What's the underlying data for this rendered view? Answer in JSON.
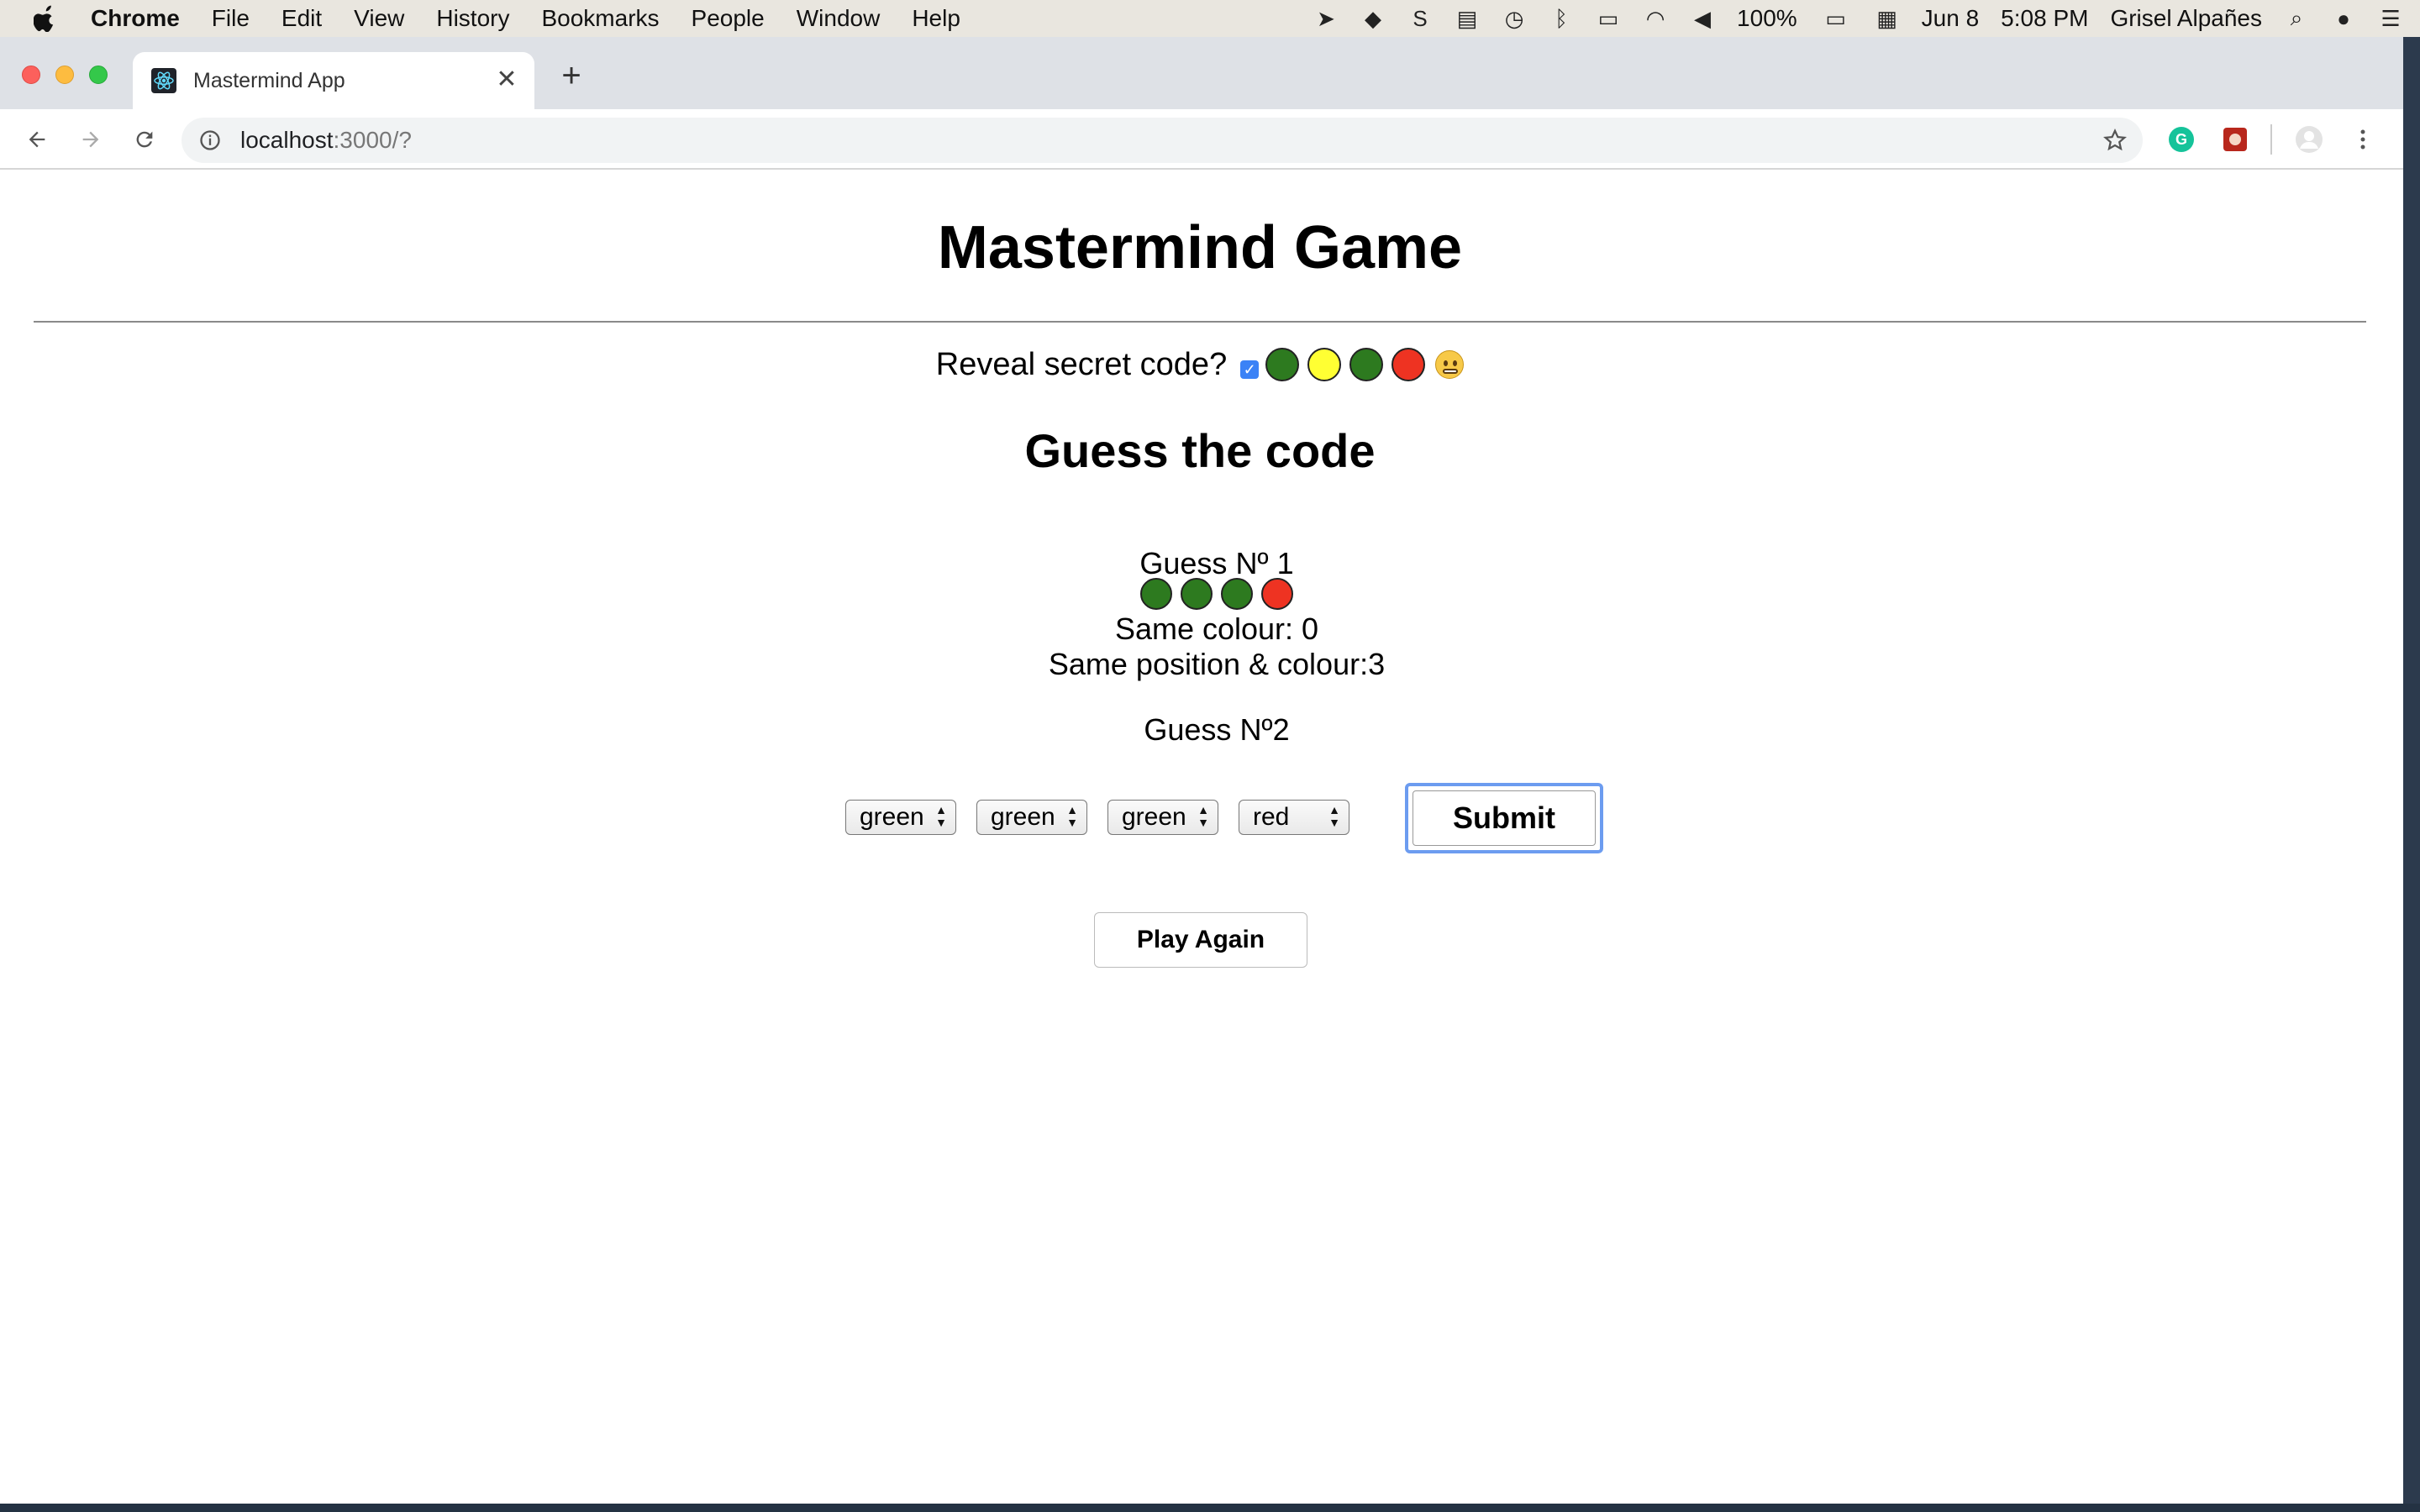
{
  "menubar": {
    "app": "Chrome",
    "items": [
      "File",
      "Edit",
      "View",
      "History",
      "Bookmarks",
      "People",
      "Window",
      "Help"
    ],
    "battery": "100%",
    "date": "Jun 8",
    "time": "5:08 PM",
    "user": "Grisel Alpañes",
    "status_icons": [
      "location-icon",
      "dropbox-icon",
      "skype-icon",
      "sync-icon",
      "time-machine-icon",
      "bluetooth-icon",
      "airplay-icon",
      "wifi-icon",
      "volume-icon",
      "battery-icon",
      "calendar-icon",
      "spotlight-icon",
      "siri-icon",
      "notification-center-icon"
    ]
  },
  "browser": {
    "tab_title": "Mastermind App",
    "url_host": "localhost",
    "url_rest": ":3000/?"
  },
  "colors": {
    "green": "#2d7a1f",
    "yellow": "#ffff33",
    "red": "#ee3322",
    "focus": "#6c9cf0"
  },
  "game": {
    "title": "Mastermind Game",
    "reveal_label": "Reveal secret code?",
    "reveal_checked": true,
    "secret_code": [
      "green",
      "yellow",
      "green",
      "red"
    ],
    "heading": "Guess the code",
    "guesses": [
      {
        "label": "Guess Nº 1",
        "pegs": [
          "green",
          "green",
          "green",
          "red"
        ],
        "same_colour": "Same colour: 0",
        "same_position": "Same position & colour:3"
      }
    ],
    "current_guess_label": "Guess Nº2",
    "selects": [
      "green",
      "green",
      "green",
      "red"
    ],
    "submit_label": "Submit",
    "play_again_label": "Play Again"
  }
}
